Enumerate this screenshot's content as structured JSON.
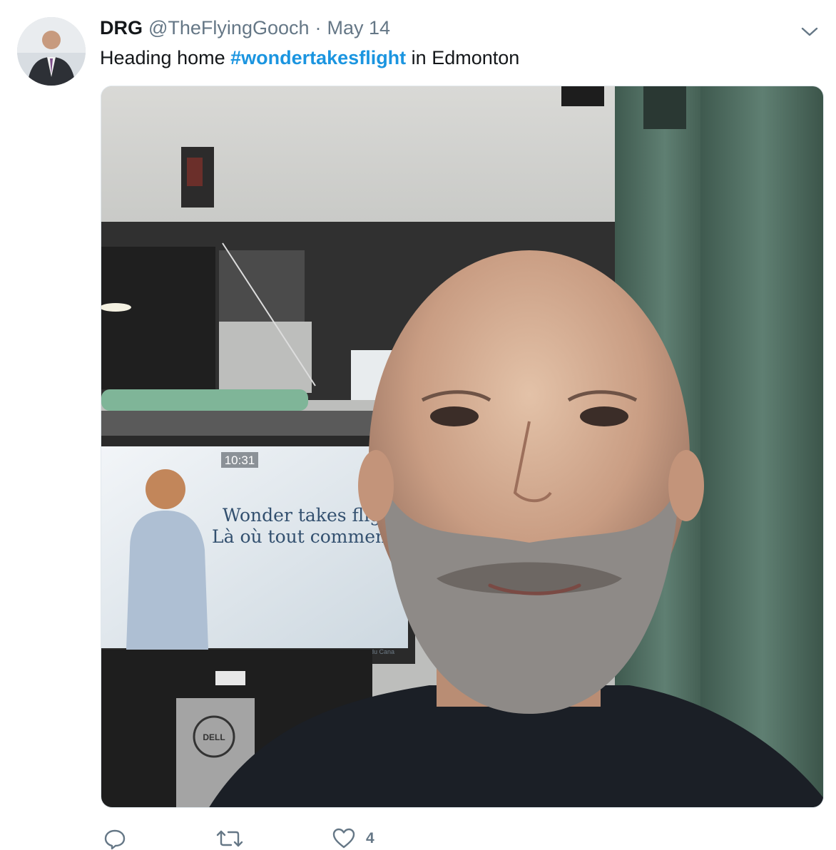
{
  "tweet": {
    "author_name": "DRG",
    "author_handle": "@TheFlyingGooch",
    "separator": "·",
    "date": "May 14",
    "text_before": "Heading home ",
    "hashtag": "#wondertakesflight",
    "text_after": " in Edmonton"
  },
  "media": {
    "screen_clock": "10:31",
    "screen_line1": "Wonder takes flig",
    "screen_line2": "Là où tout commen",
    "screen_small": "s du Cana",
    "monitor_brand": "DELL"
  },
  "actions": {
    "reply_count": "",
    "retweet_count": "",
    "like_count": "4"
  },
  "colors": {
    "link": "#1b95e0",
    "muted": "#657786",
    "text": "#14171a"
  },
  "icons": {
    "more": "chevron-down-icon",
    "reply": "reply-icon",
    "retweet": "retweet-icon",
    "like": "heart-icon"
  }
}
